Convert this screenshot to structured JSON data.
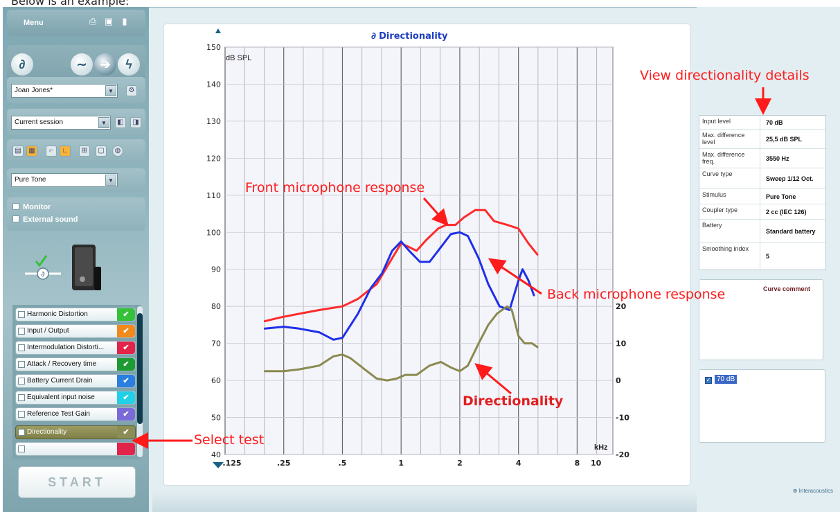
{
  "caption": "Below is an example:",
  "menu": {
    "label": "Menu"
  },
  "client": {
    "name": "Joan Jones*"
  },
  "session": {
    "value": "Current session"
  },
  "stimulus_select": {
    "value": "Pure Tone"
  },
  "options": {
    "monitor": "Monitor",
    "external_sound": "External sound"
  },
  "tests": [
    {
      "label": "Harmonic Distortion",
      "color": "#35c13a"
    },
    {
      "label": "Input / Output",
      "color": "#f08a1c"
    },
    {
      "label": "Intermodulation Distorti...",
      "color": "#e2234a"
    },
    {
      "label": "Attack / Recovery time",
      "color": "#1e9a32"
    },
    {
      "label": "Battery Current Drain",
      "color": "#2a7fe0"
    },
    {
      "label": "Equivalent input noise",
      "color": "#20d0e6"
    },
    {
      "label": "Reference Test Gain",
      "color": "#7a6ad8"
    },
    {
      "label": "Directionality",
      "color": "#9b9b62"
    }
  ],
  "start_label": "START",
  "chart_data": {
    "type": "line",
    "title": "Directionality",
    "ylabel": "dB SPL",
    "xlabel": "kHz",
    "x_ticks": [
      ".125",
      ".25",
      ".5",
      "1",
      "2",
      "4",
      "8",
      "10"
    ],
    "y_ticks": [
      "150",
      "140",
      "130",
      "120",
      "110",
      "100",
      "90",
      "80",
      "70",
      "60",
      "50",
      "40"
    ],
    "y2_ticks": [
      "20",
      "10",
      "0",
      "-10",
      "-20"
    ],
    "ylim": [
      40,
      150
    ],
    "y2lim": [
      -20,
      20
    ],
    "series": [
      {
        "color": "#ff2a2a",
        "axis": "left",
        "points": [
          [
            0.2,
            76
          ],
          [
            0.24,
            77
          ],
          [
            0.3,
            78
          ],
          [
            0.38,
            79
          ],
          [
            0.5,
            80
          ],
          [
            0.6,
            82
          ],
          [
            0.75,
            86
          ],
          [
            0.9,
            93
          ],
          [
            1.0,
            97
          ],
          [
            1.1,
            96
          ],
          [
            1.2,
            95
          ],
          [
            1.35,
            98
          ],
          [
            1.55,
            101
          ],
          [
            1.7,
            102
          ],
          [
            1.9,
            102
          ],
          [
            2.1,
            104
          ],
          [
            2.4,
            106
          ],
          [
            2.7,
            106
          ],
          [
            3.0,
            103
          ],
          [
            3.5,
            102
          ],
          [
            4.0,
            101
          ],
          [
            4.5,
            97
          ],
          [
            5.0,
            94
          ]
        ]
      },
      {
        "color": "#1f2fe8",
        "axis": "left",
        "points": [
          [
            0.2,
            74
          ],
          [
            0.25,
            74.5
          ],
          [
            0.3,
            74
          ],
          [
            0.38,
            73
          ],
          [
            0.45,
            71
          ],
          [
            0.5,
            71.5
          ],
          [
            0.6,
            78
          ],
          [
            0.7,
            85
          ],
          [
            0.8,
            89
          ],
          [
            0.9,
            95
          ],
          [
            1.0,
            97.5
          ],
          [
            1.1,
            95
          ],
          [
            1.25,
            92
          ],
          [
            1.4,
            92
          ],
          [
            1.6,
            96
          ],
          [
            1.8,
            99.5
          ],
          [
            2.0,
            100
          ],
          [
            2.2,
            99
          ],
          [
            2.5,
            93
          ],
          [
            2.8,
            86
          ],
          [
            3.2,
            80
          ],
          [
            3.6,
            79
          ],
          [
            4.0,
            87
          ],
          [
            4.2,
            90
          ],
          [
            4.5,
            87
          ],
          [
            4.8,
            83
          ]
        ]
      },
      {
        "color": "#8a8a50",
        "axis": "right",
        "points": [
          [
            0.2,
            2.5
          ],
          [
            0.25,
            2.5
          ],
          [
            0.3,
            3
          ],
          [
            0.38,
            4
          ],
          [
            0.45,
            6.5
          ],
          [
            0.5,
            7
          ],
          [
            0.55,
            6
          ],
          [
            0.65,
            3
          ],
          [
            0.75,
            0.5
          ],
          [
            0.85,
            0
          ],
          [
            0.95,
            0.5
          ],
          [
            1.05,
            1.5
          ],
          [
            1.2,
            1.5
          ],
          [
            1.4,
            4
          ],
          [
            1.6,
            5
          ],
          [
            1.8,
            3.5
          ],
          [
            2.0,
            2.5
          ],
          [
            2.2,
            4
          ],
          [
            2.5,
            10
          ],
          [
            2.8,
            15
          ],
          [
            3.1,
            18
          ],
          [
            3.5,
            20
          ],
          [
            3.7,
            19
          ],
          [
            4.0,
            12
          ],
          [
            4.3,
            10
          ],
          [
            4.7,
            10
          ],
          [
            5.0,
            9
          ]
        ]
      }
    ]
  },
  "details": [
    {
      "label": "Input level",
      "value": "70 dB"
    },
    {
      "label": "Max. difference level",
      "value": "25,5 dB SPL"
    },
    {
      "label": "Max. difference freq.",
      "value": "3550 Hz"
    },
    {
      "label": "Curve type",
      "value": "Sweep 1/12 Oct."
    },
    {
      "label": "Stimulus",
      "value": "Pure Tone"
    },
    {
      "label": "Coupler type",
      "value": "2 cc (IEC 126)"
    },
    {
      "label": "Battery",
      "value": "Standard battery"
    },
    {
      "label": "Smoothing index",
      "value": "5"
    }
  ],
  "curve_comment_label": "Curve comment",
  "legend_value": "70 dB",
  "brand": "Interacoustics",
  "annotations": {
    "view_details": "View directionality details",
    "front": "Front microphone response",
    "back": "Back microphone response",
    "directionality": "Directionality",
    "select_test": "Select test"
  }
}
